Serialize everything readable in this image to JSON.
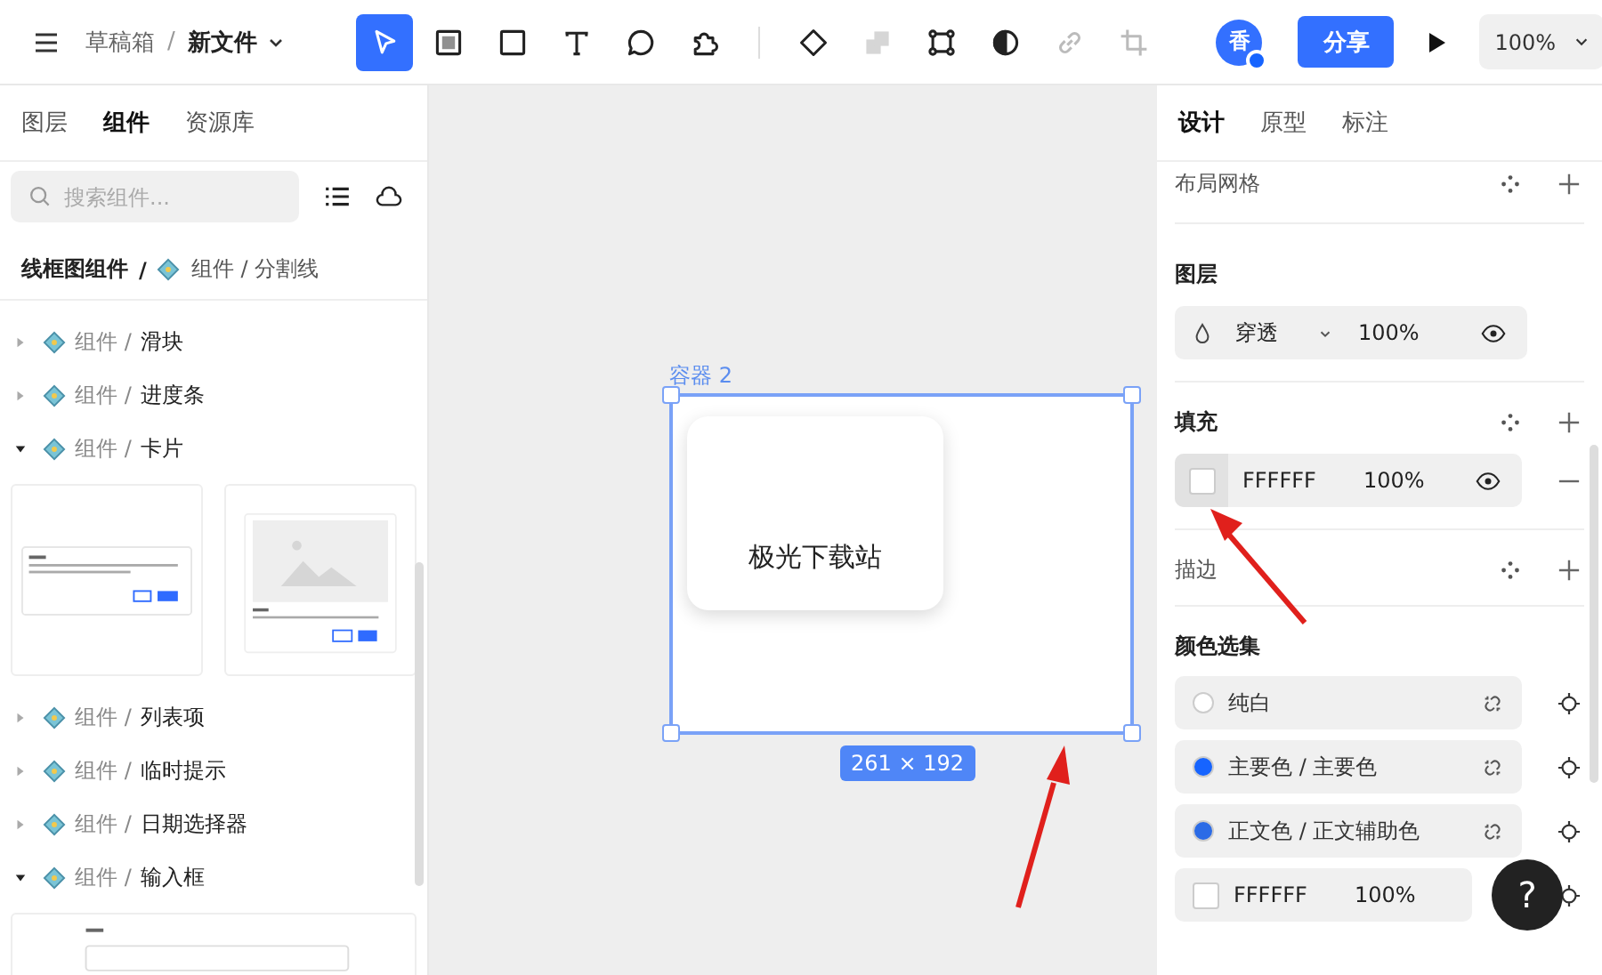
{
  "topbar": {
    "crumb_parent": "草稿箱",
    "crumb_sep": "/",
    "file_name": "新文件",
    "tools": [
      {
        "kind": "pointer",
        "selected": true,
        "disabled": false
      },
      {
        "kind": "frame",
        "selected": false,
        "disabled": false
      },
      {
        "kind": "rect",
        "selected": false,
        "disabled": false
      },
      {
        "kind": "text",
        "selected": false,
        "disabled": false
      },
      {
        "kind": "bubble",
        "selected": false,
        "disabled": false
      },
      {
        "kind": "puzzle",
        "selected": false,
        "disabled": false
      },
      {
        "kind": "component",
        "selected": false,
        "disabled": false
      },
      {
        "kind": "boolean",
        "selected": false,
        "disabled": true
      },
      {
        "kind": "bounds",
        "selected": false,
        "disabled": false
      },
      {
        "kind": "mask",
        "selected": false,
        "disabled": false
      },
      {
        "kind": "link",
        "selected": false,
        "disabled": true
      },
      {
        "kind": "crop",
        "selected": false,
        "disabled": true
      }
    ],
    "avatar": "香",
    "share": "分享",
    "zoom": "100%"
  },
  "left": {
    "tabs": [
      {
        "label": "图层",
        "selected": false
      },
      {
        "label": "组件",
        "selected": true
      },
      {
        "label": "资源库",
        "selected": false
      }
    ],
    "search": {
      "placeholder": "搜索组件..."
    },
    "path_root": "线框图组件",
    "path_sep": "/",
    "path_current": "组件 / 分割线",
    "items": [
      {
        "prefix": "组件 /",
        "name": "滑块",
        "expanded": false
      },
      {
        "prefix": "组件 /",
        "name": "进度条",
        "expanded": false
      },
      {
        "prefix": "组件 /",
        "name": "卡片",
        "expanded": true,
        "previews": [
          {
            "kind": "card"
          },
          {
            "kind": "image-card"
          }
        ]
      },
      {
        "prefix": "组件 /",
        "name": "列表项",
        "expanded": false
      },
      {
        "prefix": "组件 /",
        "name": "临时提示",
        "expanded": false
      },
      {
        "prefix": "组件 /",
        "name": "日期选择器",
        "expanded": false
      },
      {
        "prefix": "组件 /",
        "name": "输入框",
        "expanded": true,
        "previews": [
          {
            "kind": "input"
          }
        ]
      }
    ]
  },
  "canvas": {
    "frame_label": "容器 2",
    "card_text": "极光下载站",
    "size": "261 × 192"
  },
  "right": {
    "tabs": [
      {
        "label": "设计",
        "selected": true
      },
      {
        "label": "原型",
        "selected": false
      },
      {
        "label": "标注",
        "selected": false
      }
    ],
    "grid_title": "布局网格",
    "layer_title": "图层",
    "blend": "穿透",
    "opacity": "100%",
    "fill_title": "填充",
    "fill": {
      "hex": "FFFFFF",
      "opacity": "100%"
    },
    "stroke_title": "描边",
    "styles_title": "颜色选集",
    "styles": [
      {
        "kind": "style",
        "label": "纯白",
        "color": "#ffffff"
      },
      {
        "kind": "style",
        "label": "主要色 / 主要色",
        "color": "#1664ff"
      },
      {
        "kind": "style",
        "label": "正文色 / 正文辅助色",
        "color": "#2b6be6"
      },
      {
        "kind": "fill",
        "hex": "FFFFFF",
        "opacity": "100%",
        "color": "#ffffff"
      }
    ],
    "help": "?"
  }
}
